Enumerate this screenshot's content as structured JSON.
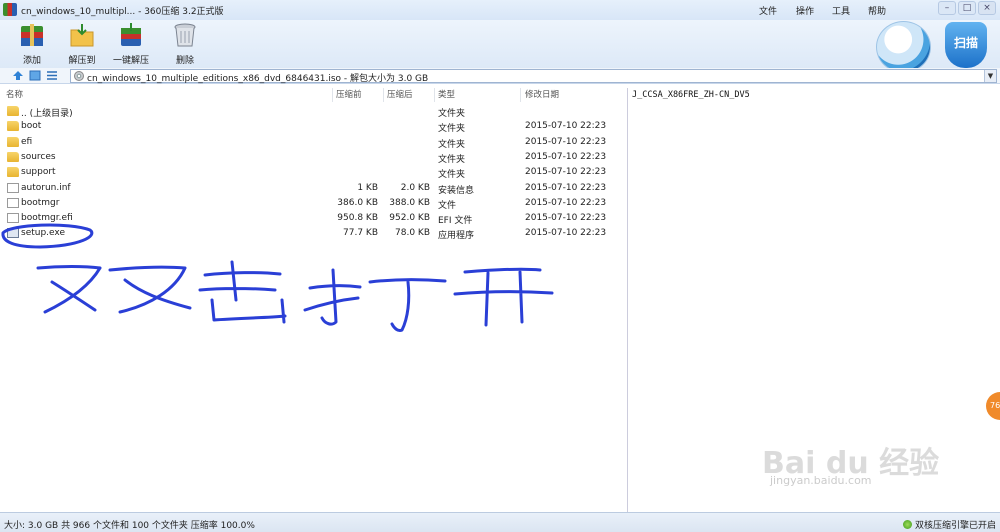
{
  "window": {
    "title": "cn_windows_10_multipl... - 360压缩 3.2正式版",
    "menus": [
      "文件",
      "操作",
      "工具",
      "帮助"
    ]
  },
  "toolbar": {
    "add_label": "添加",
    "extract_to_label": "解压到",
    "one_click_extract_label": "一键解压",
    "delete_label": "删除",
    "scan_label": "扫描"
  },
  "address": {
    "text": "cn_windows_10_multiple_editions_x86_dvd_6846431.iso - 解包大小为 3.0 GB"
  },
  "columns": {
    "name": "名称",
    "packed": "压缩前",
    "unpacked": "压缩后",
    "type": "类型",
    "modified": "修改日期"
  },
  "files": [
    {
      "name": ".. (上级目录)",
      "packed": "",
      "unpacked": "",
      "type": "文件夹",
      "modified": "",
      "icon": "folder-icon"
    },
    {
      "name": "boot",
      "packed": "",
      "unpacked": "",
      "type": "文件夹",
      "modified": "2015-07-10 22:23",
      "icon": "folder-icon"
    },
    {
      "name": "efi",
      "packed": "",
      "unpacked": "",
      "type": "文件夹",
      "modified": "2015-07-10 22:23",
      "icon": "folder-icon"
    },
    {
      "name": "sources",
      "packed": "",
      "unpacked": "",
      "type": "文件夹",
      "modified": "2015-07-10 22:23",
      "icon": "folder-icon"
    },
    {
      "name": "support",
      "packed": "",
      "unpacked": "",
      "type": "文件夹",
      "modified": "2015-07-10 22:23",
      "icon": "folder-icon"
    },
    {
      "name": "autorun.inf",
      "packed": "1 KB",
      "unpacked": "2.0 KB",
      "type": "安装信息",
      "modified": "2015-07-10 22:23",
      "icon": "inf-file-icon"
    },
    {
      "name": "bootmgr",
      "packed": "386.0 KB",
      "unpacked": "388.0 KB",
      "type": "文件",
      "modified": "2015-07-10 22:23",
      "icon": "file-icon"
    },
    {
      "name": "bootmgr.efi",
      "packed": "950.8 KB",
      "unpacked": "952.0 KB",
      "type": "EFI 文件",
      "modified": "2015-07-10 22:23",
      "icon": "file-icon"
    },
    {
      "name": "setup.exe",
      "packed": "77.7 KB",
      "unpacked": "78.0 KB",
      "type": "应用程序",
      "modified": "2015-07-10 22:23",
      "icon": "exe-icon"
    }
  ],
  "right_pane": {
    "volume_label": "J_CCSA_X86FRE_ZH-CN_DV5"
  },
  "status": {
    "summary": "大小: 3.0 GB 共 966 个文件和 100 个文件夹 压缩率 100.0%",
    "engine": "双核压缩引擎已开启"
  },
  "overlay": {
    "badge": "76",
    "watermark": "Bai du 经验",
    "watermark_url": "jingyan.baidu.com"
  },
  "colors": {
    "annotation_ink": "#2a3fd6",
    "folder": "#e8b431",
    "titlebar": "#dde9f7"
  }
}
